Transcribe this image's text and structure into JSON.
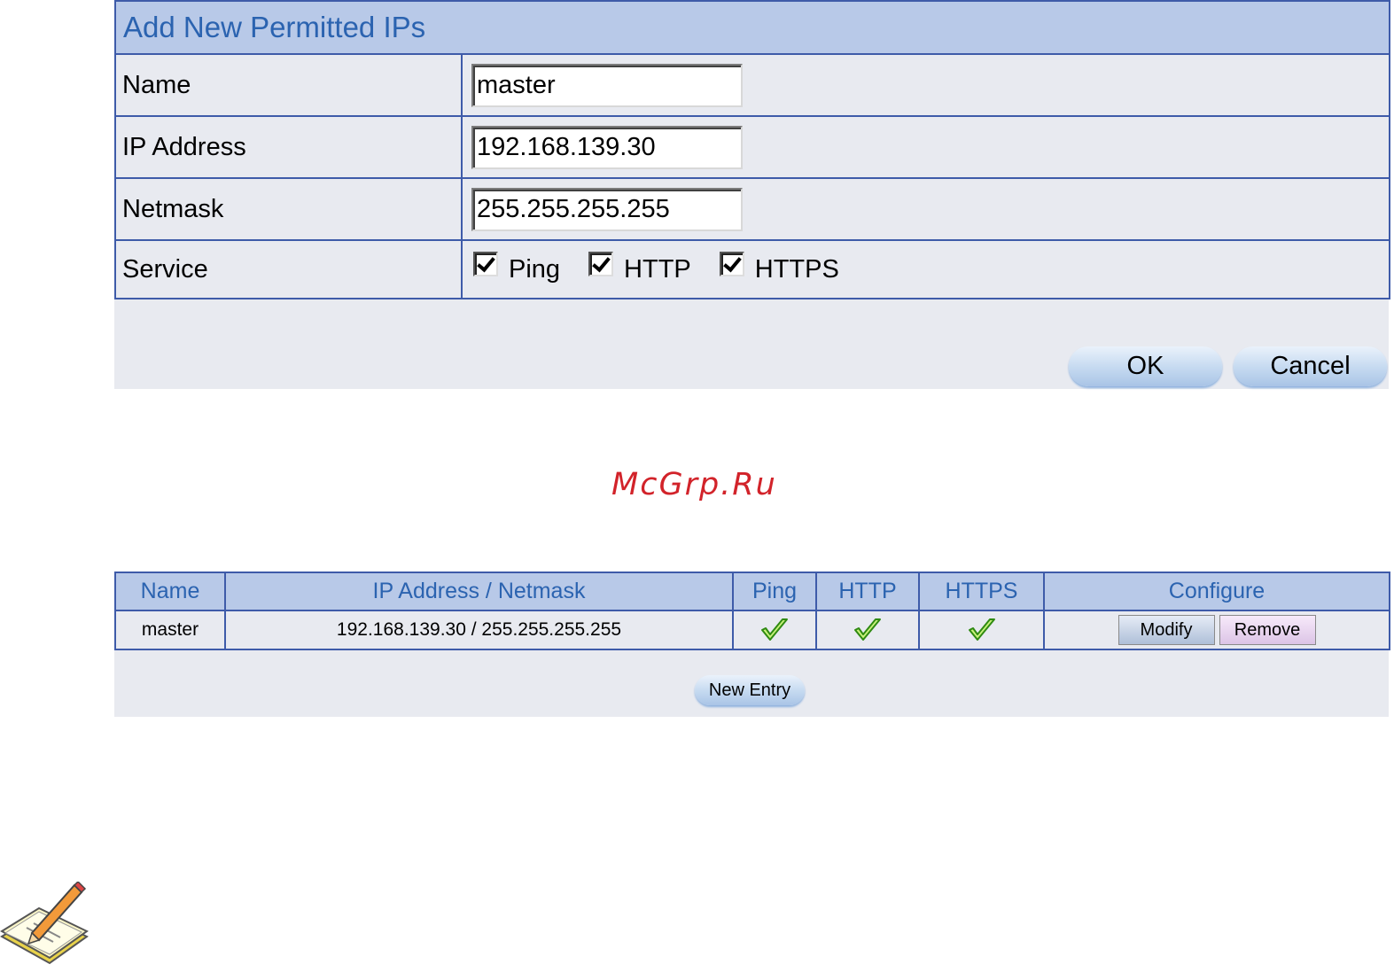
{
  "form": {
    "title": "Add New Permitted IPs",
    "fields": {
      "name_label": "Name",
      "name_value": "master",
      "ip_label": "IP Address",
      "ip_value": "192.168.139.30",
      "netmask_label": "Netmask",
      "netmask_value": "255.255.255.255",
      "service_label": "Service"
    },
    "services": [
      {
        "label": "Ping",
        "checked": true
      },
      {
        "label": "HTTP",
        "checked": true
      },
      {
        "label": "HTTPS",
        "checked": true
      }
    ],
    "ok_label": "OK",
    "cancel_label": "Cancel"
  },
  "watermark": "McGrp.Ru",
  "list": {
    "headers": {
      "name": "Name",
      "ip_netmask": "IP Address / Netmask",
      "ping": "Ping",
      "http": "HTTP",
      "https": "HTTPS",
      "configure": "Configure"
    },
    "rows": [
      {
        "name": "master",
        "ip_netmask": "192.168.139.30 / 255.255.255.255",
        "ping": true,
        "http": true,
        "https": true,
        "modify_label": "Modify",
        "remove_label": "Remove"
      }
    ],
    "new_entry_label": "New Entry"
  },
  "icons": {
    "check": "check-icon",
    "note": "note-pencil-icon"
  },
  "colors": {
    "header_bg": "#b8c9e8",
    "header_text": "#2b63b0",
    "border": "#3e5ba9",
    "cell_bg": "#e8eaf0",
    "watermark": "#d2232a"
  }
}
